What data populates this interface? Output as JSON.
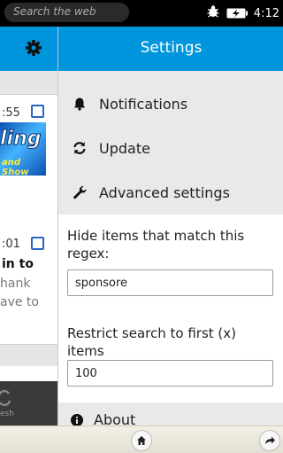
{
  "status_bar": {
    "search_placeholder": "Search the web",
    "time": "4:12",
    "icons": [
      "bug-icon",
      "battery-charging-icon"
    ]
  },
  "background_list": {
    "time_1": ":55",
    "thumbnail_text_1": "ling",
    "thumbnail_text_2": "and Show",
    "time_2": ":01",
    "headline_fragment": "in to",
    "body_fragment_1": "hank",
    "body_fragment_2": "ave to",
    "bottom_label": "esh"
  },
  "settings": {
    "title": "Settings",
    "menu": [
      {
        "label": "Notifications",
        "icon": "bell-icon"
      },
      {
        "label": "Update",
        "icon": "refresh-icon"
      },
      {
        "label": "Advanced settings",
        "icon": "wrench-icon"
      }
    ],
    "filter_label": "Hide items that match this regex:",
    "filter_value": "sponsore",
    "limit_label": "Restrict search to first (x) items",
    "limit_value": "100",
    "about_label": "About"
  },
  "colors": {
    "header_blue": "#0095dd",
    "menu_bg": "#e9e9e9"
  }
}
